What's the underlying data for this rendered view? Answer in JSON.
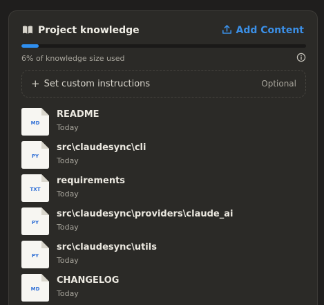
{
  "header": {
    "title": "Project knowledge",
    "title_icon": "book-icon",
    "add_label": "Add Content",
    "add_icon": "upload-icon"
  },
  "usage": {
    "percent": 6,
    "label": "6% of knowledge size used",
    "info_icon": "info-icon"
  },
  "custom_instructions": {
    "label": "Set custom instructions",
    "optional_label": "Optional",
    "icon": "plus-icon"
  },
  "files": [
    {
      "name": "README",
      "type": "MD",
      "date": "Today"
    },
    {
      "name": "src\\claudesync\\cli",
      "type": "PY",
      "date": "Today"
    },
    {
      "name": "requirements",
      "type": "TXT",
      "date": "Today"
    },
    {
      "name": "src\\claudesync\\providers\\claude_ai",
      "type": "PY",
      "date": "Today"
    },
    {
      "name": "src\\claudesync\\utils",
      "type": "PY",
      "date": "Today"
    },
    {
      "name": "CHANGELOG",
      "type": "MD",
      "date": "Today"
    }
  ],
  "colors": {
    "accent": "#2f8ff0",
    "background": "#1f1e1d",
    "panel": "#2b2a27",
    "file_type_text": "#2f6fd6"
  }
}
